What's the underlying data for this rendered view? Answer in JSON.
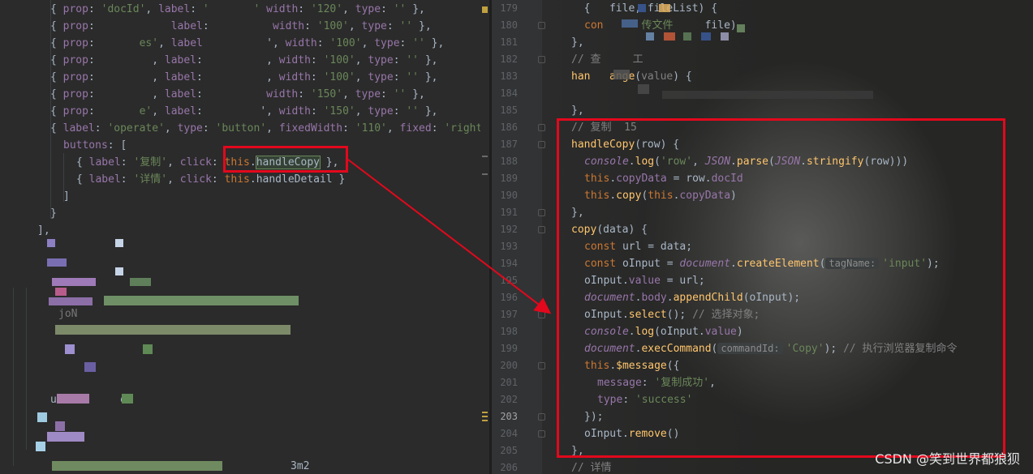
{
  "left_pane": {
    "lines": [
      {
        "html_key": "l1"
      },
      {
        "html_key": "l2"
      }
    ],
    "l1_a": "{ ",
    "l1_prop": "prop",
    "l1_v1": "'docId'",
    "l1_label": "label",
    "l1_width": "width",
    "l1_wv": "'120'",
    "l1_type": "type",
    "l1_tv": "''",
    "row_prop": "prop",
    "row_label": "label",
    "row_width": "width",
    "row_type": "type",
    "w100": "'100'",
    "w150": "'150'",
    "empty": "''",
    "row7_label_frag": "label: 'operate', type: 'button', fixedWidth: '110', fixed: 'right",
    "operate_label": "'operate'",
    "operate_type": "'button'",
    "operate_fixed_width": "'110'",
    "operate_fixed": "'right",
    "buttons": "buttons",
    "btn1_label": "'复制'",
    "btn1_handler": "handleCopy",
    "btn2_label": "'详情'",
    "btn2_handler": "handleDetail",
    "this_kw": "this",
    "click_kw": "click",
    "frag_es": "es'",
    "frag_label_short": "label",
    "frag_e": "e'",
    "frag_ua_e": "e:",
    "frag_u": "u",
    "frag_3m2": "3m2",
    "frag_joN": "joN"
  },
  "right_pane": {
    "line_numbers": [
      "179",
      "180",
      "181",
      "182",
      "183",
      "184",
      "185",
      "186",
      "187",
      "188",
      "189",
      "190",
      "191",
      "192",
      "193",
      "194",
      "195",
      "196",
      "197",
      "198",
      "199",
      "200",
      "201",
      "202",
      "203",
      "204",
      "205",
      "206"
    ],
    "current_line": "203",
    "l179": {
      "a": "file, fileList) {"
    },
    "l180": {
      "a": "con",
      "b": "传文件",
      "c": "file)"
    },
    "l182_comment": "// 查",
    "l182_frag": "工",
    "l183_a": "han",
    "l183_b": "ange",
    "l183_param": "value",
    "l186_comment": "// 复制",
    "l186_frag": "15",
    "handleCopy": "handleCopy",
    "row": "row",
    "console": "console",
    "log": "log",
    "row_str": "'row'",
    "JSON": "JSON",
    "parse": "parse",
    "stringify": "stringify",
    "this": "this",
    "copyData": "copyData",
    "docId": "docId",
    "copy": "copy",
    "data": "data",
    "const": "const",
    "url": "url",
    "oInput": "oInput",
    "document": "document",
    "createElement": "createElement",
    "hint_tagName": "tagName:",
    "input_str": "'input'",
    "value": "value",
    "body": "body",
    "appendChild": "appendChild",
    "select": "select",
    "comment_select": "// 选择对象;",
    "execCommand": "execCommand",
    "hint_commandId": "commandId:",
    "copy_str": "'Copy'",
    "comment_exec": "// 执行浏览器复制命令",
    "message_fn": "$message",
    "message_key": "message",
    "message_val": "'复制成功'",
    "type_key": "type",
    "type_val": "'success'",
    "remove": "remove",
    "comment_detail": "// 详情"
  },
  "left_line_numbers_hidden": true,
  "watermark": "CSDN @笑到世界都狼狈",
  "colors": {
    "highlight_box": "#e3081c",
    "arrow": "#e3081c"
  }
}
